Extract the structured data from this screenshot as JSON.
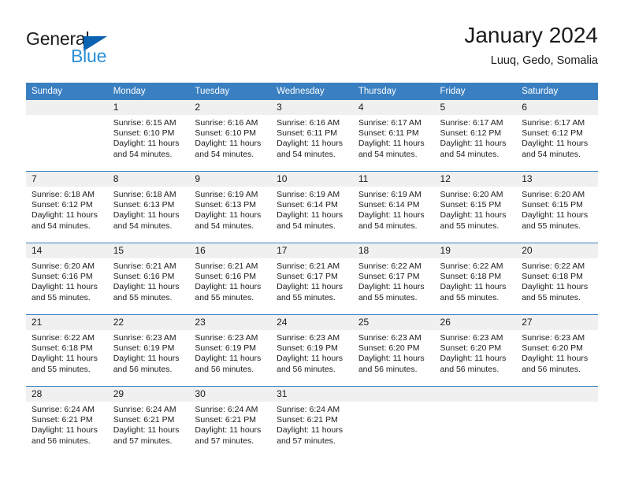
{
  "brand": {
    "name_part1": "General",
    "name_part2": "Blue",
    "triangle_color": "#0a62b0",
    "blue_color": "#2b8fd9"
  },
  "header": {
    "title": "January 2024",
    "subtitle": "Luuq, Gedo, Somalia"
  },
  "theme": {
    "header_bg": "#3a7fc1",
    "header_text": "#ffffff",
    "daynum_bg": "#f0f0f0",
    "grid_line": "#3a7fc1"
  },
  "weekdays": [
    "Sunday",
    "Monday",
    "Tuesday",
    "Wednesday",
    "Thursday",
    "Friday",
    "Saturday"
  ],
  "weeks": [
    [
      {
        "day": "",
        "empty": true,
        "sunrise": "",
        "sunset": "",
        "daylight1": "",
        "daylight2": ""
      },
      {
        "day": "1",
        "sunrise": "Sunrise: 6:15 AM",
        "sunset": "Sunset: 6:10 PM",
        "daylight1": "Daylight: 11 hours",
        "daylight2": "and 54 minutes."
      },
      {
        "day": "2",
        "sunrise": "Sunrise: 6:16 AM",
        "sunset": "Sunset: 6:10 PM",
        "daylight1": "Daylight: 11 hours",
        "daylight2": "and 54 minutes."
      },
      {
        "day": "3",
        "sunrise": "Sunrise: 6:16 AM",
        "sunset": "Sunset: 6:11 PM",
        "daylight1": "Daylight: 11 hours",
        "daylight2": "and 54 minutes."
      },
      {
        "day": "4",
        "sunrise": "Sunrise: 6:17 AM",
        "sunset": "Sunset: 6:11 PM",
        "daylight1": "Daylight: 11 hours",
        "daylight2": "and 54 minutes."
      },
      {
        "day": "5",
        "sunrise": "Sunrise: 6:17 AM",
        "sunset": "Sunset: 6:12 PM",
        "daylight1": "Daylight: 11 hours",
        "daylight2": "and 54 minutes."
      },
      {
        "day": "6",
        "sunrise": "Sunrise: 6:17 AM",
        "sunset": "Sunset: 6:12 PM",
        "daylight1": "Daylight: 11 hours",
        "daylight2": "and 54 minutes."
      }
    ],
    [
      {
        "day": "7",
        "sunrise": "Sunrise: 6:18 AM",
        "sunset": "Sunset: 6:12 PM",
        "daylight1": "Daylight: 11 hours",
        "daylight2": "and 54 minutes."
      },
      {
        "day": "8",
        "sunrise": "Sunrise: 6:18 AM",
        "sunset": "Sunset: 6:13 PM",
        "daylight1": "Daylight: 11 hours",
        "daylight2": "and 54 minutes."
      },
      {
        "day": "9",
        "sunrise": "Sunrise: 6:19 AM",
        "sunset": "Sunset: 6:13 PM",
        "daylight1": "Daylight: 11 hours",
        "daylight2": "and 54 minutes."
      },
      {
        "day": "10",
        "sunrise": "Sunrise: 6:19 AM",
        "sunset": "Sunset: 6:14 PM",
        "daylight1": "Daylight: 11 hours",
        "daylight2": "and 54 minutes."
      },
      {
        "day": "11",
        "sunrise": "Sunrise: 6:19 AM",
        "sunset": "Sunset: 6:14 PM",
        "daylight1": "Daylight: 11 hours",
        "daylight2": "and 54 minutes."
      },
      {
        "day": "12",
        "sunrise": "Sunrise: 6:20 AM",
        "sunset": "Sunset: 6:15 PM",
        "daylight1": "Daylight: 11 hours",
        "daylight2": "and 55 minutes."
      },
      {
        "day": "13",
        "sunrise": "Sunrise: 6:20 AM",
        "sunset": "Sunset: 6:15 PM",
        "daylight1": "Daylight: 11 hours",
        "daylight2": "and 55 minutes."
      }
    ],
    [
      {
        "day": "14",
        "sunrise": "Sunrise: 6:20 AM",
        "sunset": "Sunset: 6:16 PM",
        "daylight1": "Daylight: 11 hours",
        "daylight2": "and 55 minutes."
      },
      {
        "day": "15",
        "sunrise": "Sunrise: 6:21 AM",
        "sunset": "Sunset: 6:16 PM",
        "daylight1": "Daylight: 11 hours",
        "daylight2": "and 55 minutes."
      },
      {
        "day": "16",
        "sunrise": "Sunrise: 6:21 AM",
        "sunset": "Sunset: 6:16 PM",
        "daylight1": "Daylight: 11 hours",
        "daylight2": "and 55 minutes."
      },
      {
        "day": "17",
        "sunrise": "Sunrise: 6:21 AM",
        "sunset": "Sunset: 6:17 PM",
        "daylight1": "Daylight: 11 hours",
        "daylight2": "and 55 minutes."
      },
      {
        "day": "18",
        "sunrise": "Sunrise: 6:22 AM",
        "sunset": "Sunset: 6:17 PM",
        "daylight1": "Daylight: 11 hours",
        "daylight2": "and 55 minutes."
      },
      {
        "day": "19",
        "sunrise": "Sunrise: 6:22 AM",
        "sunset": "Sunset: 6:18 PM",
        "daylight1": "Daylight: 11 hours",
        "daylight2": "and 55 minutes."
      },
      {
        "day": "20",
        "sunrise": "Sunrise: 6:22 AM",
        "sunset": "Sunset: 6:18 PM",
        "daylight1": "Daylight: 11 hours",
        "daylight2": "and 55 minutes."
      }
    ],
    [
      {
        "day": "21",
        "sunrise": "Sunrise: 6:22 AM",
        "sunset": "Sunset: 6:18 PM",
        "daylight1": "Daylight: 11 hours",
        "daylight2": "and 55 minutes."
      },
      {
        "day": "22",
        "sunrise": "Sunrise: 6:23 AM",
        "sunset": "Sunset: 6:19 PM",
        "daylight1": "Daylight: 11 hours",
        "daylight2": "and 56 minutes."
      },
      {
        "day": "23",
        "sunrise": "Sunrise: 6:23 AM",
        "sunset": "Sunset: 6:19 PM",
        "daylight1": "Daylight: 11 hours",
        "daylight2": "and 56 minutes."
      },
      {
        "day": "24",
        "sunrise": "Sunrise: 6:23 AM",
        "sunset": "Sunset: 6:19 PM",
        "daylight1": "Daylight: 11 hours",
        "daylight2": "and 56 minutes."
      },
      {
        "day": "25",
        "sunrise": "Sunrise: 6:23 AM",
        "sunset": "Sunset: 6:20 PM",
        "daylight1": "Daylight: 11 hours",
        "daylight2": "and 56 minutes."
      },
      {
        "day": "26",
        "sunrise": "Sunrise: 6:23 AM",
        "sunset": "Sunset: 6:20 PM",
        "daylight1": "Daylight: 11 hours",
        "daylight2": "and 56 minutes."
      },
      {
        "day": "27",
        "sunrise": "Sunrise: 6:23 AM",
        "sunset": "Sunset: 6:20 PM",
        "daylight1": "Daylight: 11 hours",
        "daylight2": "and 56 minutes."
      }
    ],
    [
      {
        "day": "28",
        "sunrise": "Sunrise: 6:24 AM",
        "sunset": "Sunset: 6:21 PM",
        "daylight1": "Daylight: 11 hours",
        "daylight2": "and 56 minutes."
      },
      {
        "day": "29",
        "sunrise": "Sunrise: 6:24 AM",
        "sunset": "Sunset: 6:21 PM",
        "daylight1": "Daylight: 11 hours",
        "daylight2": "and 57 minutes."
      },
      {
        "day": "30",
        "sunrise": "Sunrise: 6:24 AM",
        "sunset": "Sunset: 6:21 PM",
        "daylight1": "Daylight: 11 hours",
        "daylight2": "and 57 minutes."
      },
      {
        "day": "31",
        "sunrise": "Sunrise: 6:24 AM",
        "sunset": "Sunset: 6:21 PM",
        "daylight1": "Daylight: 11 hours",
        "daylight2": "and 57 minutes."
      },
      {
        "day": "",
        "empty": true,
        "sunrise": "",
        "sunset": "",
        "daylight1": "",
        "daylight2": ""
      },
      {
        "day": "",
        "empty": true,
        "sunrise": "",
        "sunset": "",
        "daylight1": "",
        "daylight2": ""
      },
      {
        "day": "",
        "empty": true,
        "sunrise": "",
        "sunset": "",
        "daylight1": "",
        "daylight2": ""
      }
    ]
  ]
}
